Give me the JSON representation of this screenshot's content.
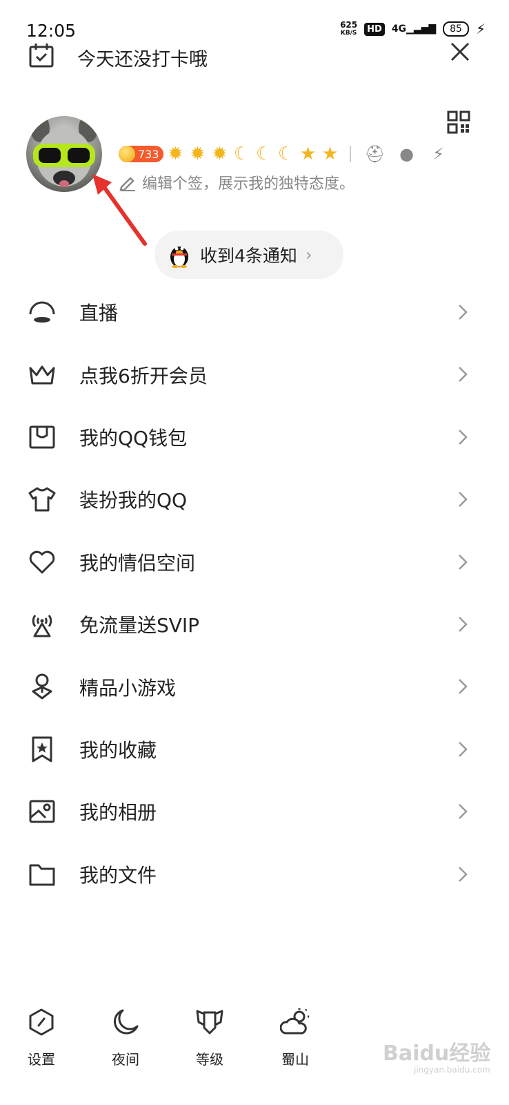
{
  "status_bar": {
    "time": "12:05",
    "net_speed": "625",
    "net_unit": "KB/S",
    "hd": "HD",
    "signal": "4G",
    "battery": "85"
  },
  "header": {
    "checkin_text": "今天还没打卡哦"
  },
  "profile": {
    "coin_count": "733",
    "level_icons": [
      "sun",
      "sun",
      "sun",
      "moon",
      "moon",
      "moon",
      "star",
      "star"
    ],
    "signature_placeholder": "编辑个签，展示我的独特态度。"
  },
  "notification": {
    "label": "收到4条通知"
  },
  "menu": {
    "items": [
      {
        "label": "直播",
        "icon": "live-icon"
      },
      {
        "label": "点我6折开会员",
        "icon": "crown-icon"
      },
      {
        "label": "我的QQ钱包",
        "icon": "wallet-icon"
      },
      {
        "label": "装扮我的QQ",
        "icon": "tshirt-icon"
      },
      {
        "label": "我的情侣空间",
        "icon": "heart-icon"
      },
      {
        "label": "免流量送SVIP",
        "icon": "broadcast-tower-icon"
      },
      {
        "label": "精品小游戏",
        "icon": "game-map-pin-icon"
      },
      {
        "label": "我的收藏",
        "icon": "bookmark-star-icon"
      },
      {
        "label": "我的相册",
        "icon": "photo-album-icon"
      },
      {
        "label": "我的文件",
        "icon": "folder-icon"
      }
    ]
  },
  "bottom_bar": {
    "settings": "设置",
    "night": "夜间",
    "level": "等级",
    "weather": "蜀山"
  },
  "watermark": {
    "text": "Baidu经验",
    "sub": "jingyan.baidu.com"
  },
  "colors": {
    "accent_red": "#e5322d",
    "coin_orange": "#f35a2c",
    "gold": "#f2b51c",
    "text": "#222222",
    "muted": "#888888"
  }
}
